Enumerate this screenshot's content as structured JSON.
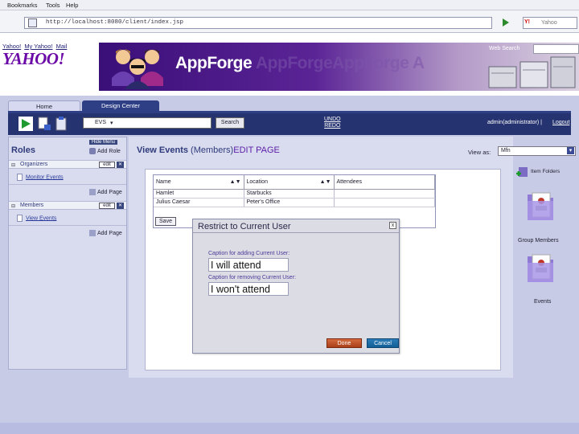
{
  "menubar": [
    "Bookmarks",
    "Tools",
    "Help"
  ],
  "address": {
    "url": "http://localhost:8080/client/index.jsp",
    "search_placeholder": "Yahoo",
    "search_logo": "Y!"
  },
  "header": {
    "yahoo_links": [
      "Yahoo!",
      "My Yahoo!",
      "Mail"
    ],
    "yahoo_logo": "YAHOO!",
    "brand": "AppForge",
    "brand_ghost": "AppForgeAppForge A",
    "web_search_label": "Web Search"
  },
  "tabs": [
    {
      "label": "Home"
    },
    {
      "label": "Design Center"
    }
  ],
  "toolbar": {
    "pages_value": "EVS",
    "search_label": "Search",
    "undo_label": "UNDO",
    "redo_label": "REDO",
    "user_label": "admin(administrator) |",
    "logout_label": "Logout",
    "icons": [
      "play-icon",
      "add-page-icon",
      "clipboard-icon"
    ]
  },
  "left_panel": {
    "hide_menu": "Hide Menu",
    "title": "Roles",
    "add_role": "Add Role",
    "roles": [
      {
        "name": "Organizers",
        "edit": "edit",
        "pages": [
          "Monitor Events"
        ],
        "add_page": "Add Page"
      },
      {
        "name": "Members",
        "edit": "edit",
        "pages": [
          "View Events"
        ],
        "add_page": "Add Page"
      }
    ]
  },
  "main": {
    "title_part1": "View Events",
    "title_part2": " (Members)",
    "title_part3": "EDIT PAGE",
    "view_as_label": "View as:",
    "view_as_value": "Mfn"
  },
  "table": {
    "columns": [
      "Name",
      "Location",
      "Attendees"
    ],
    "sort_arrows": "▲▼",
    "rows": [
      [
        "Hamlet",
        "Starbucks",
        ""
      ],
      [
        "Julius Caesar",
        "Peter's Office",
        ""
      ]
    ],
    "save_label": "Save"
  },
  "right_panel": {
    "item_folder": "Item Folders",
    "folders": [
      "Group Members",
      "Events"
    ]
  },
  "modal": {
    "title": "Restrict to Current User",
    "close": "x",
    "caption_add_label": "Caption for adding Current User:",
    "caption_add_value": "I will attend",
    "caption_remove_label": "Caption for removing Current User:",
    "caption_remove_value": "I won't attend",
    "done_label": "Done",
    "cancel_label": "Cancel"
  }
}
